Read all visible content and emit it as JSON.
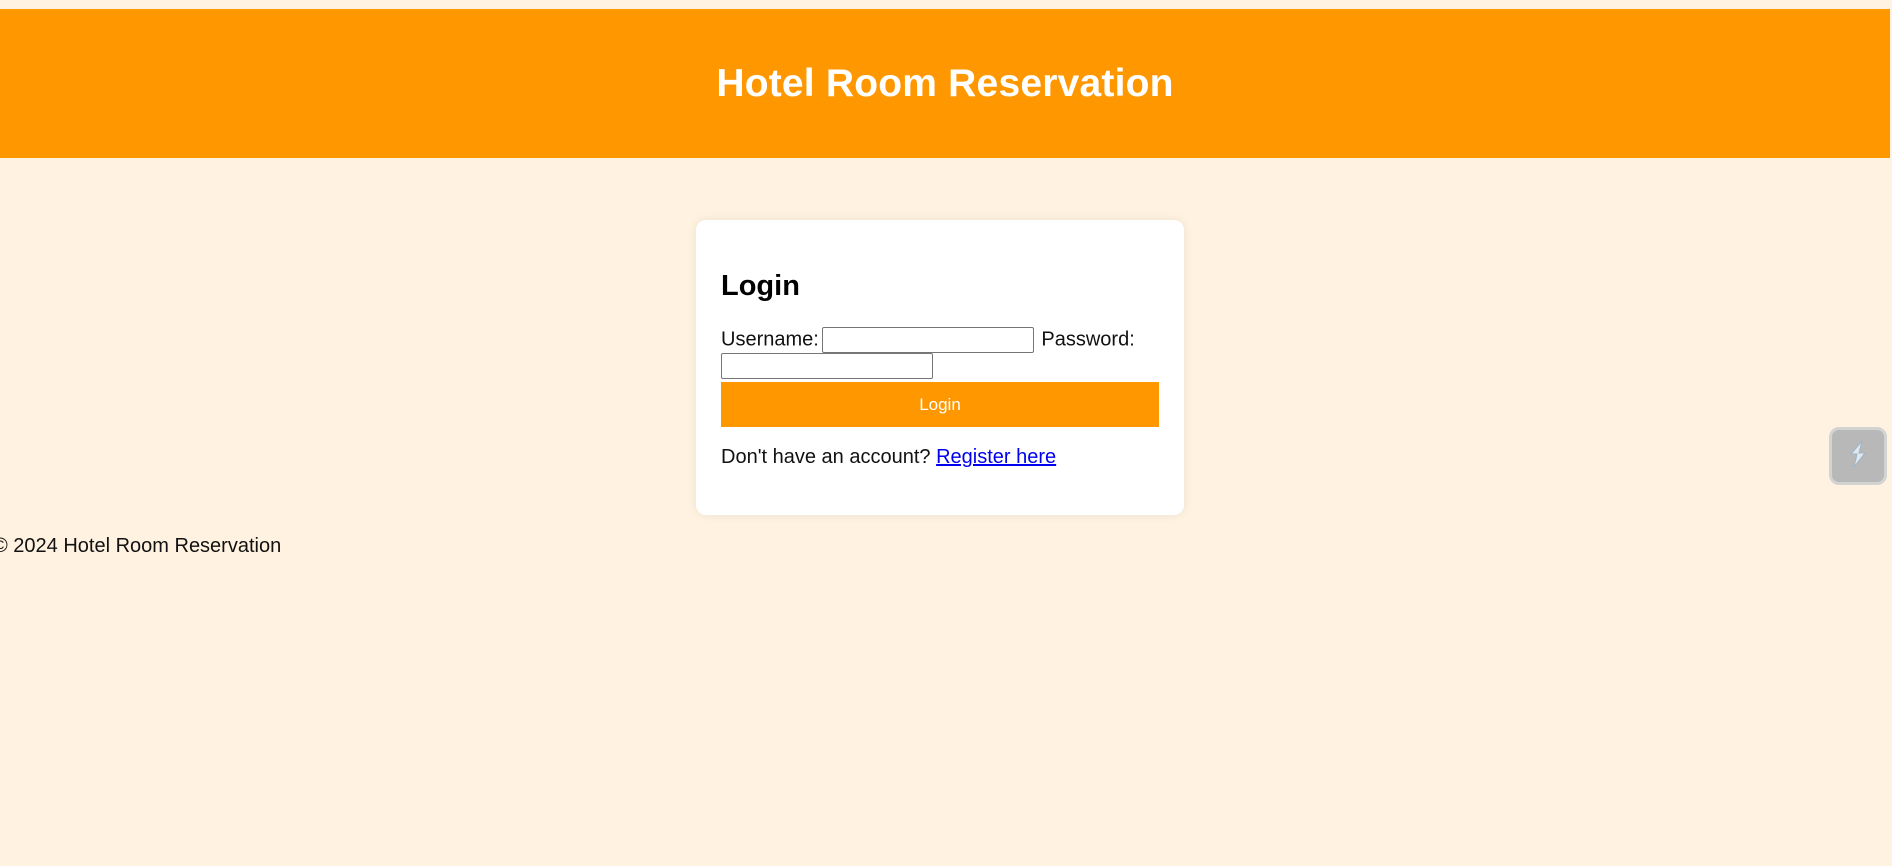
{
  "header": {
    "title": "Hotel Room Reservation"
  },
  "login": {
    "heading": "Login",
    "username_label": "Username:",
    "username_value": "",
    "password_label": "Password:",
    "password_value": "",
    "submit_label": "Login"
  },
  "register": {
    "prompt": "Don't have an account?",
    "link_text": "Register here"
  },
  "footer": {
    "text": "© 2024 Hotel Room Reservation"
  },
  "side_widget": {
    "icon": "lightning-icon"
  },
  "colors": {
    "accent": "#ff9800",
    "background": "#fff2e0",
    "card": "#ffffff",
    "link": "#0000ee"
  }
}
